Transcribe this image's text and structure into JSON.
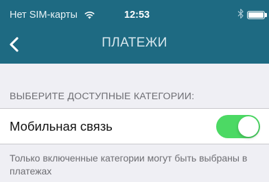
{
  "status_bar": {
    "carrier": "Нет SIM-карты",
    "time": "12:53"
  },
  "nav": {
    "title": "ПЛАТЕЖИ",
    "back_icon": "chevron-left-icon"
  },
  "settings": {
    "section_header": "ВЫБЕРИТЕ ДОСТУПНЫЕ КАТЕГОРИИ:",
    "items": [
      {
        "label": "Мобильная связь",
        "enabled": true
      }
    ],
    "footer": "Только включенные категории могут быть выбраны в платежах"
  },
  "colors": {
    "nav_background": "#1e6a82",
    "toggle_on": "#4cd964",
    "page_background": "#efeff4"
  }
}
